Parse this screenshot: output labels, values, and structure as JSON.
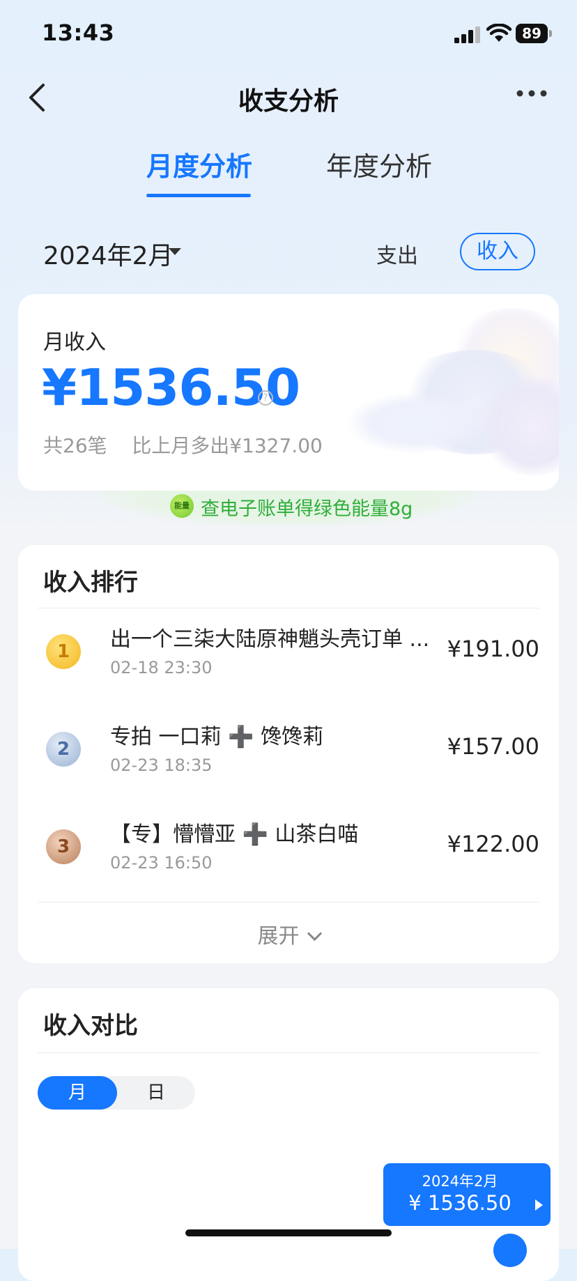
{
  "status_bar": {
    "time": "13:43",
    "battery": "89"
  },
  "nav": {
    "title": "收支分析"
  },
  "tabs": [
    {
      "label": "月度分析",
      "active": true
    },
    {
      "label": "年度分析",
      "active": false
    }
  ],
  "period": {
    "label": "2024年2月"
  },
  "type_switch": {
    "expense": "支出",
    "income": "收入",
    "selected": "收入"
  },
  "monthly": {
    "label": "月收入",
    "amount": "¥1536.50",
    "help": "?",
    "summary": "共26笔    比上月多出¥1327.00"
  },
  "energy": {
    "icon_text": "能量",
    "text": "查电子账单得绿色能量8g"
  },
  "ranking": {
    "title": "收入排行",
    "items": [
      {
        "rank": "1",
        "name": "出一个三柒大陆原神魈头壳订单 ...",
        "time": "02-18 23:30",
        "amount": "¥191.00"
      },
      {
        "rank": "2",
        "name": "专拍 一口莉 ➕ 馋馋莉",
        "time": "02-23 18:35",
        "amount": "¥157.00"
      },
      {
        "rank": "3",
        "name": "【专】懵懵亚 ➕ 山茶白喵",
        "time": "02-23 16:50",
        "amount": "¥122.00"
      }
    ],
    "expand": "展开"
  },
  "compare": {
    "title": "收入对比",
    "toggle": {
      "month": "月",
      "day": "日",
      "selected": "月"
    },
    "tooltip": {
      "period": "2024年2月",
      "amount": "¥ 1536.50"
    }
  },
  "colors": {
    "accent": "#1677ff",
    "energy_green": "#2fae3a"
  },
  "icons": [
    "back-chevron-icon",
    "more-dots-icon",
    "caret-down-icon",
    "help-icon",
    "energy-icon",
    "chevron-down-icon",
    "signal-icon",
    "wifi-icon",
    "battery-icon"
  ]
}
